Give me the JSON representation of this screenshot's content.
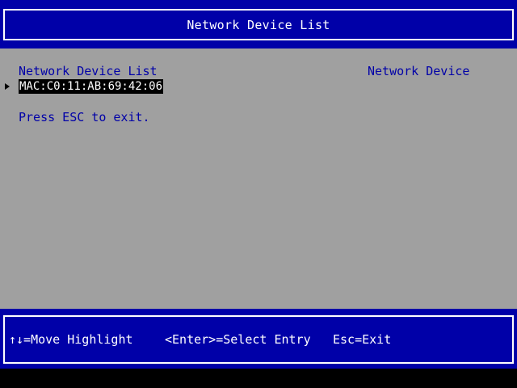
{
  "header": {
    "title": "Network Device List"
  },
  "main": {
    "list_title": "Network Device List",
    "help_title": "Network Device",
    "entries": [
      {
        "label": "MAC:C0:11:AB:69:42:06",
        "selected": true
      }
    ],
    "hint": "Press ESC to exit."
  },
  "footer": {
    "move": "↑↓=Move Highlight",
    "enter": "<Enter>=Select Entry",
    "esc": "Esc=Exit"
  },
  "colors": {
    "background": "#a0a0a0",
    "bar": "#0000a8",
    "text_accent": "#0000a8",
    "highlight_bg": "#000000",
    "highlight_fg": "#ffffff"
  }
}
